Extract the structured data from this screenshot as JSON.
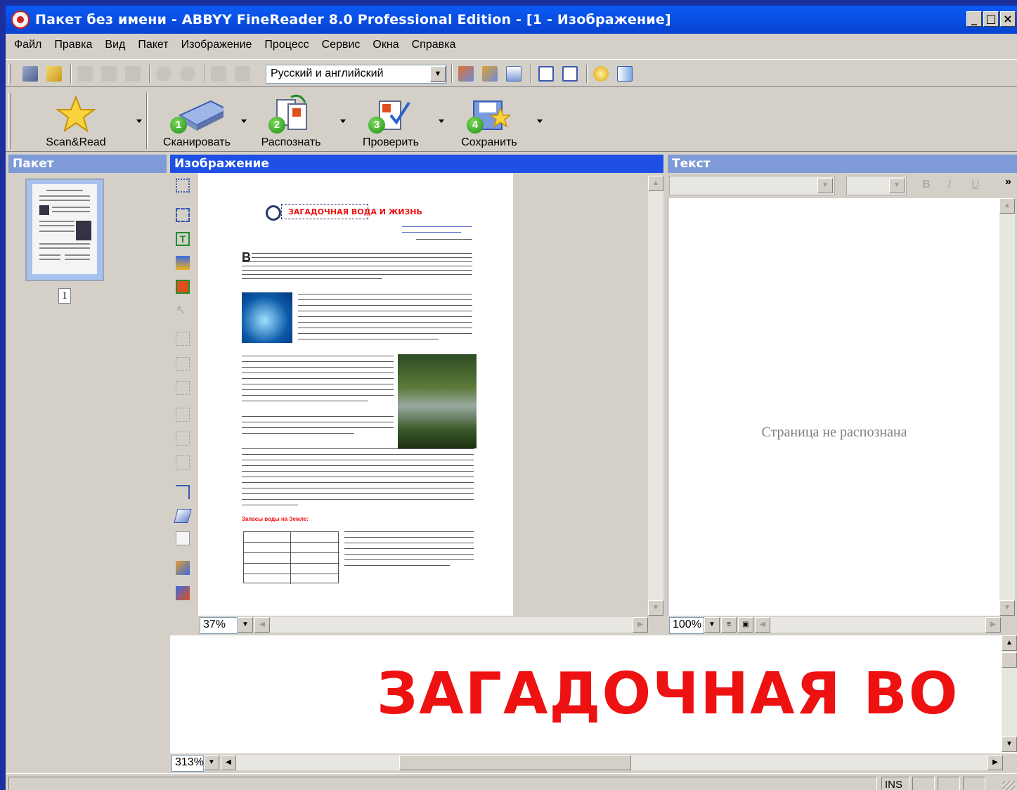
{
  "window": {
    "title": "Пакет без имени - ABBYY FineReader 8.0 Professional Edition - [1 - Изображение]",
    "controls": {
      "minimize": "_",
      "maximize": "□",
      "close": "×"
    }
  },
  "menu": [
    "Файл",
    "Правка",
    "Вид",
    "Пакет",
    "Изображение",
    "Процесс",
    "Сервис",
    "Окна",
    "Справка"
  ],
  "toolbar": {
    "language": "Русский и английский"
  },
  "actions": [
    {
      "label": "Scan&Read",
      "step": ""
    },
    {
      "label": "Сканировать",
      "step": "1"
    },
    {
      "label": "Распознать",
      "step": "2"
    },
    {
      "label": "Проверить",
      "step": "3"
    },
    {
      "label": "Сохранить",
      "step": "4"
    }
  ],
  "panes": {
    "batch": {
      "title": "Пакет",
      "page_number": "1"
    },
    "image": {
      "title": "Изображение",
      "zoom": "37%",
      "doc_heading": "ЗАГАДОЧНАЯ ВОДА И ЖИЗНЬ",
      "doc_subheading": "Запасы воды на Земле:"
    },
    "text": {
      "title": "Текст",
      "zoom": "100%",
      "placeholder": "Страница не распознана",
      "overflow": "»"
    },
    "zoom": {
      "zoom": "313%",
      "preview_text": "ЗАГАДОЧНАЯ ВО"
    }
  },
  "status": {
    "ins": "INS"
  },
  "colors": {
    "title_bar": "#0842d0",
    "pane_header": "#1e50e6",
    "accent_red": "#ee1111"
  }
}
